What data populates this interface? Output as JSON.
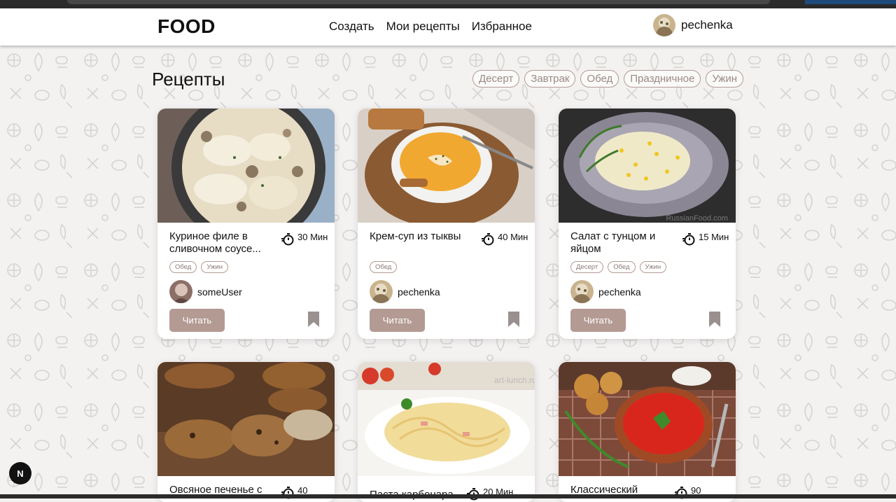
{
  "header": {
    "logo": "FOOD",
    "nav": [
      "Создать",
      "Мои рецепты",
      "Избранное"
    ],
    "username": "pechenka"
  },
  "page": {
    "title": "Рецепты",
    "filters": [
      "Десерт",
      "Завтрак",
      "Обед",
      "Праздничное",
      "Ужин"
    ]
  },
  "recipes": [
    {
      "title": "Куриное филе в сливочном соусе...",
      "time": "30 Мин",
      "tags": [
        "Обед",
        "Ужин"
      ],
      "author": "someUser",
      "button": "Читать"
    },
    {
      "title": "Крем-суп из тыквы",
      "time": "40 Мин",
      "tags": [
        "Обед"
      ],
      "author": "pechenka",
      "button": "Читать"
    },
    {
      "title": "Салат с тунцом и яйцом",
      "time": "15 Мин",
      "tags": [
        "Десерт",
        "Обед",
        "Ужин"
      ],
      "author": "pechenka",
      "button": "Читать"
    },
    {
      "title": "Овсяное печенье с",
      "time": "40",
      "tags": [],
      "author": "",
      "button": ""
    },
    {
      "title": "Паста карбонара",
      "time": "20 Мин",
      "tags": [],
      "author": "",
      "button": ""
    },
    {
      "title": "Классический",
      "time": "90",
      "tags": [],
      "author": "",
      "button": ""
    }
  ],
  "watermarks": [
    "RussianFood.com",
    "art-lunch.ru"
  ],
  "dev_badge": "N",
  "colors": {
    "accent": "#b39a93",
    "background": "#f3f2f1",
    "card": "#ffffff"
  }
}
